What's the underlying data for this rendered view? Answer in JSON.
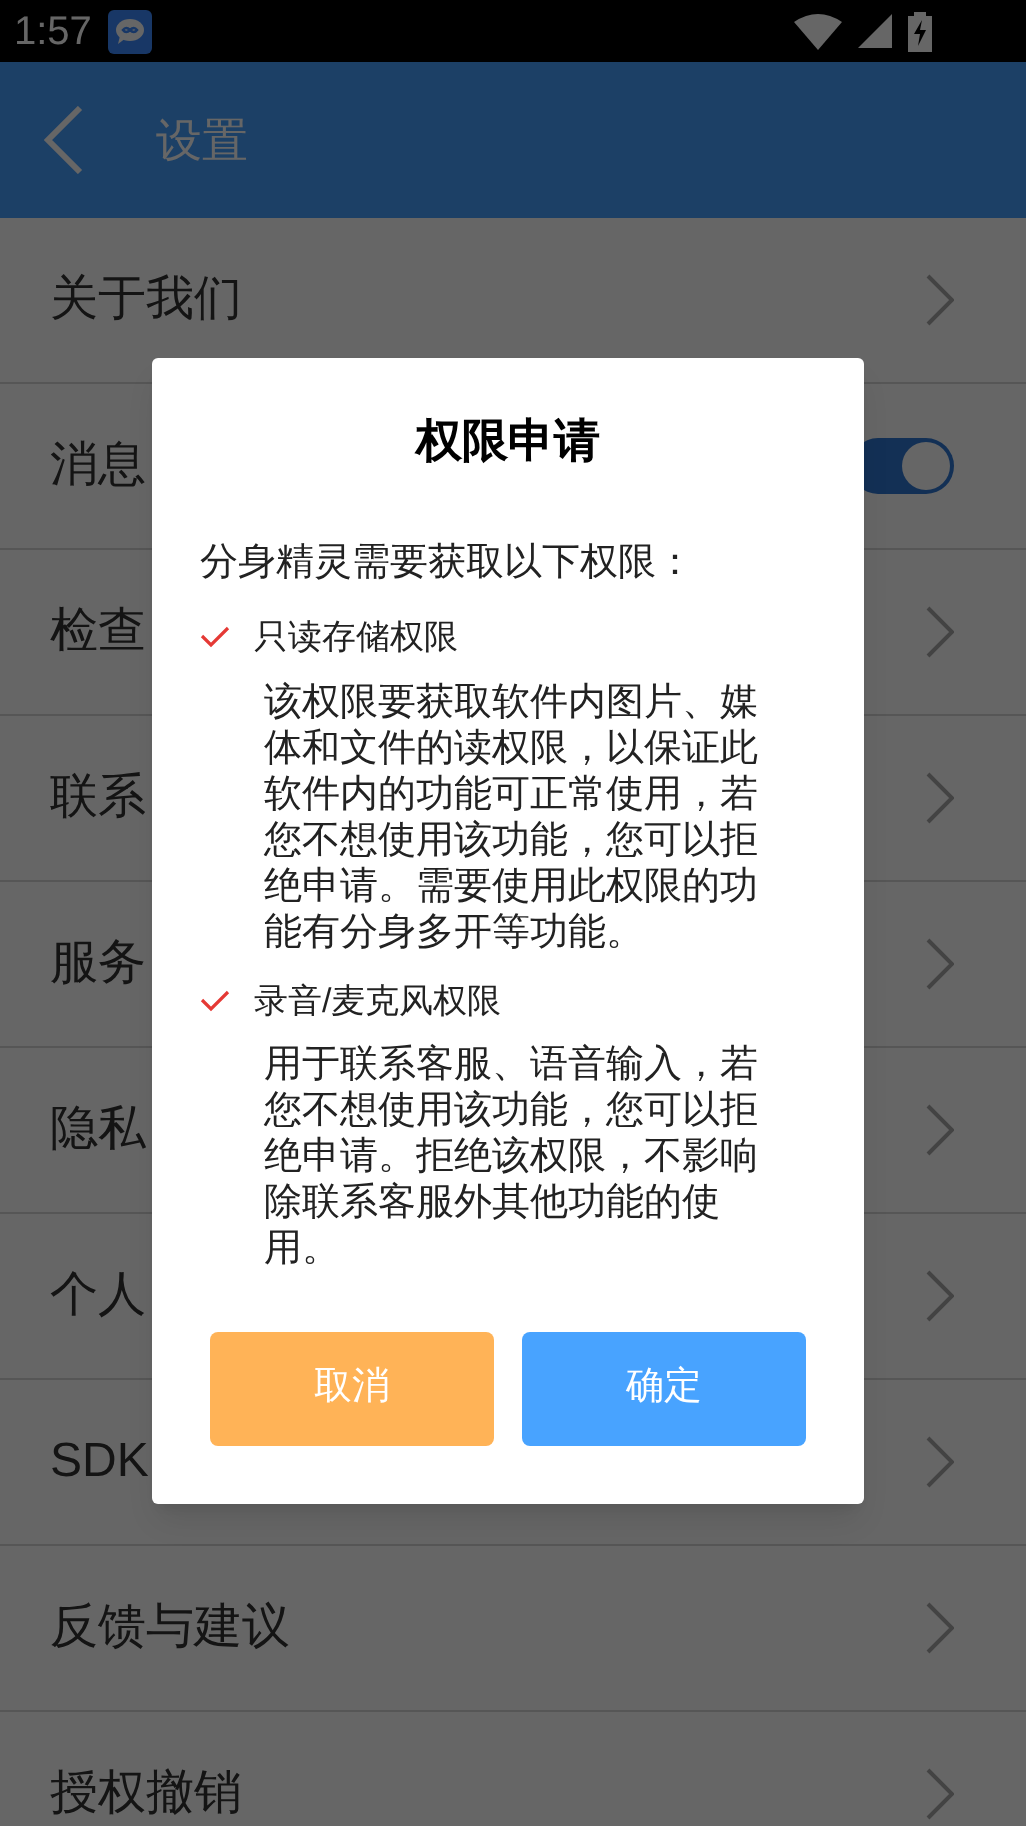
{
  "status_bar": {
    "time": "1:57"
  },
  "app_bar": {
    "title": "设置"
  },
  "settings": [
    {
      "label": "关于我们",
      "kind": "link"
    },
    {
      "label": "消息",
      "kind": "switch",
      "on": true
    },
    {
      "label": "检查",
      "kind": "link"
    },
    {
      "label": "联系",
      "kind": "link"
    },
    {
      "label": "服务",
      "kind": "link"
    },
    {
      "label": "隐私",
      "kind": "link"
    },
    {
      "label": "个人",
      "kind": "link"
    },
    {
      "label": "SDK",
      "kind": "link"
    },
    {
      "label": "反馈与建议",
      "kind": "link"
    },
    {
      "label": "授权撤销",
      "kind": "link"
    }
  ],
  "dialog": {
    "title": "权限申请",
    "intro": "分身精灵需要获取以下权限：",
    "permissions": [
      {
        "name": "只读存储权限",
        "description": "该权限要获取软件内图片、媒体和文件的读权限，以保证此软件内的功能可正常使用，若您不想使用该功能，您可以拒绝申请。需要使用此权限的功能有分身多开等功能。"
      },
      {
        "name": "录音/麦克风权限",
        "description": "用于联系客服、语音输入，若您不想使用该功能，您可以拒绝申请。拒绝该权限，不影响除联系客服外其他功能的使用。"
      }
    ],
    "buttons": [
      {
        "label": "取消",
        "kind": "cancel"
      },
      {
        "label": "确定",
        "kind": "confirm"
      }
    ]
  }
}
